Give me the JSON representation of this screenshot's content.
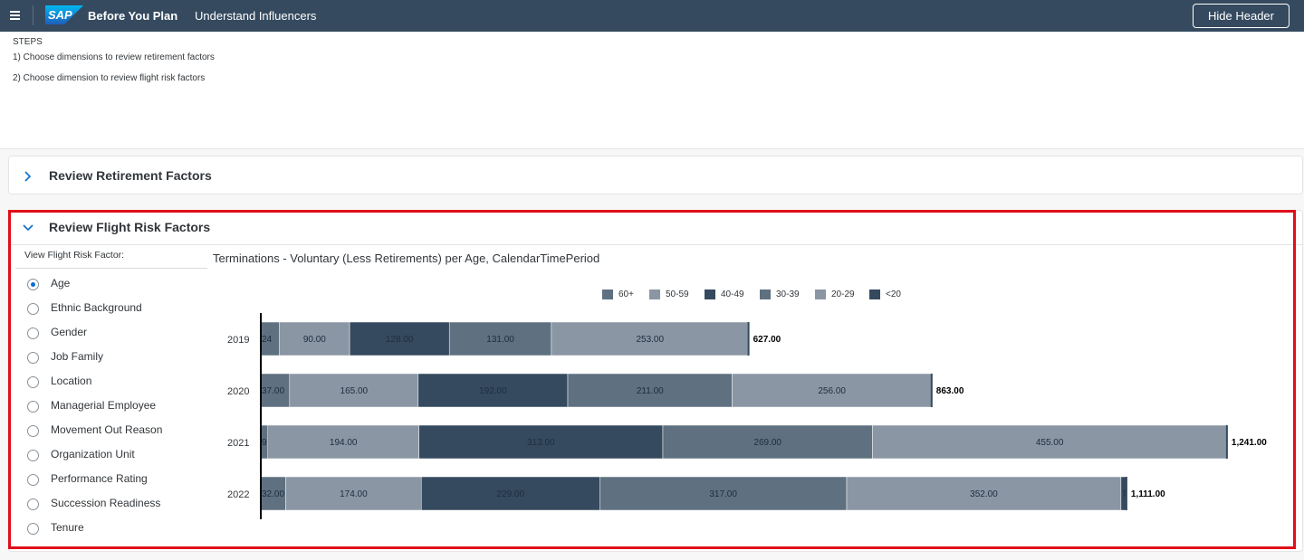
{
  "shell": {
    "logo_text": "SAP",
    "app_title": "Before You Plan",
    "page_link": "Understand Influencers",
    "hide_header_label": "Hide Header"
  },
  "steps": {
    "title": "STEPS",
    "items": [
      "1) Choose dimensions to review retirement factors",
      "2) Choose dimension to review flight risk factors"
    ]
  },
  "sections": {
    "retirement": {
      "title": "Review Retirement Factors",
      "expanded": false
    },
    "flight_risk": {
      "title": "Review Flight Risk Factors",
      "expanded": true
    }
  },
  "factor_selector": {
    "label": "View Flight Risk Factor:",
    "selected": "Age",
    "options": [
      "Age",
      "Ethnic Background",
      "Gender",
      "Job Family",
      "Location",
      "Managerial Employee",
      "Movement Out Reason",
      "Organization Unit",
      "Performance Rating",
      "Succession Readiness",
      "Tenure"
    ]
  },
  "colors": {
    "shell_bg": "#354a5f",
    "accent": "#0a6ed1",
    "highlight": "#e00d1a"
  },
  "chart_data": {
    "type": "bar",
    "orientation": "horizontal",
    "stacked": true,
    "title": "Terminations - Voluntary (Less Retirements) per Age, CalendarTimePeriod",
    "legend_position": "top",
    "categories": [
      "2019",
      "2020",
      "2021",
      "2022"
    ],
    "series": [
      {
        "name": "<20",
        "color": "#354a5f",
        "values": [
          null,
          null,
          null,
          7
        ],
        "labels": [
          "",
          "",
          "",
          "7"
        ]
      },
      {
        "name": "20-29",
        "color": "#8a96a3",
        "values": [
          253,
          256,
          455,
          352
        ],
        "labels": [
          "253.00",
          "256.00",
          "455.00",
          "352.00"
        ]
      },
      {
        "name": "30-39",
        "color": "#5f7080",
        "values": [
          131,
          211,
          269,
          317
        ],
        "labels": [
          "131.00",
          "211.00",
          "269.00",
          "317.00"
        ]
      },
      {
        "name": "40-49",
        "color": "#354a5f",
        "values": [
          128,
          192,
          313,
          229
        ],
        "labels": [
          "128.00",
          "192.00",
          "313.00",
          "229.00"
        ]
      },
      {
        "name": "50-59",
        "color": "#8a96a3",
        "values": [
          90,
          165,
          194,
          174
        ],
        "labels": [
          "90.00",
          "165.00",
          "194.00",
          "174.00"
        ]
      },
      {
        "name": "60+",
        "color": "#5f7080",
        "values": [
          24,
          37,
          9,
          32
        ],
        "labels": [
          "24",
          "37.00",
          "9",
          "32.00"
        ]
      }
    ],
    "legend_order": [
      "60+",
      "50-59",
      "40-49",
      "30-39",
      "20-29",
      "<20"
    ],
    "totals": [
      627,
      863,
      1241,
      1111
    ],
    "total_labels": [
      "627.00",
      "863.00",
      "1,241.00",
      "1,111.00"
    ]
  }
}
